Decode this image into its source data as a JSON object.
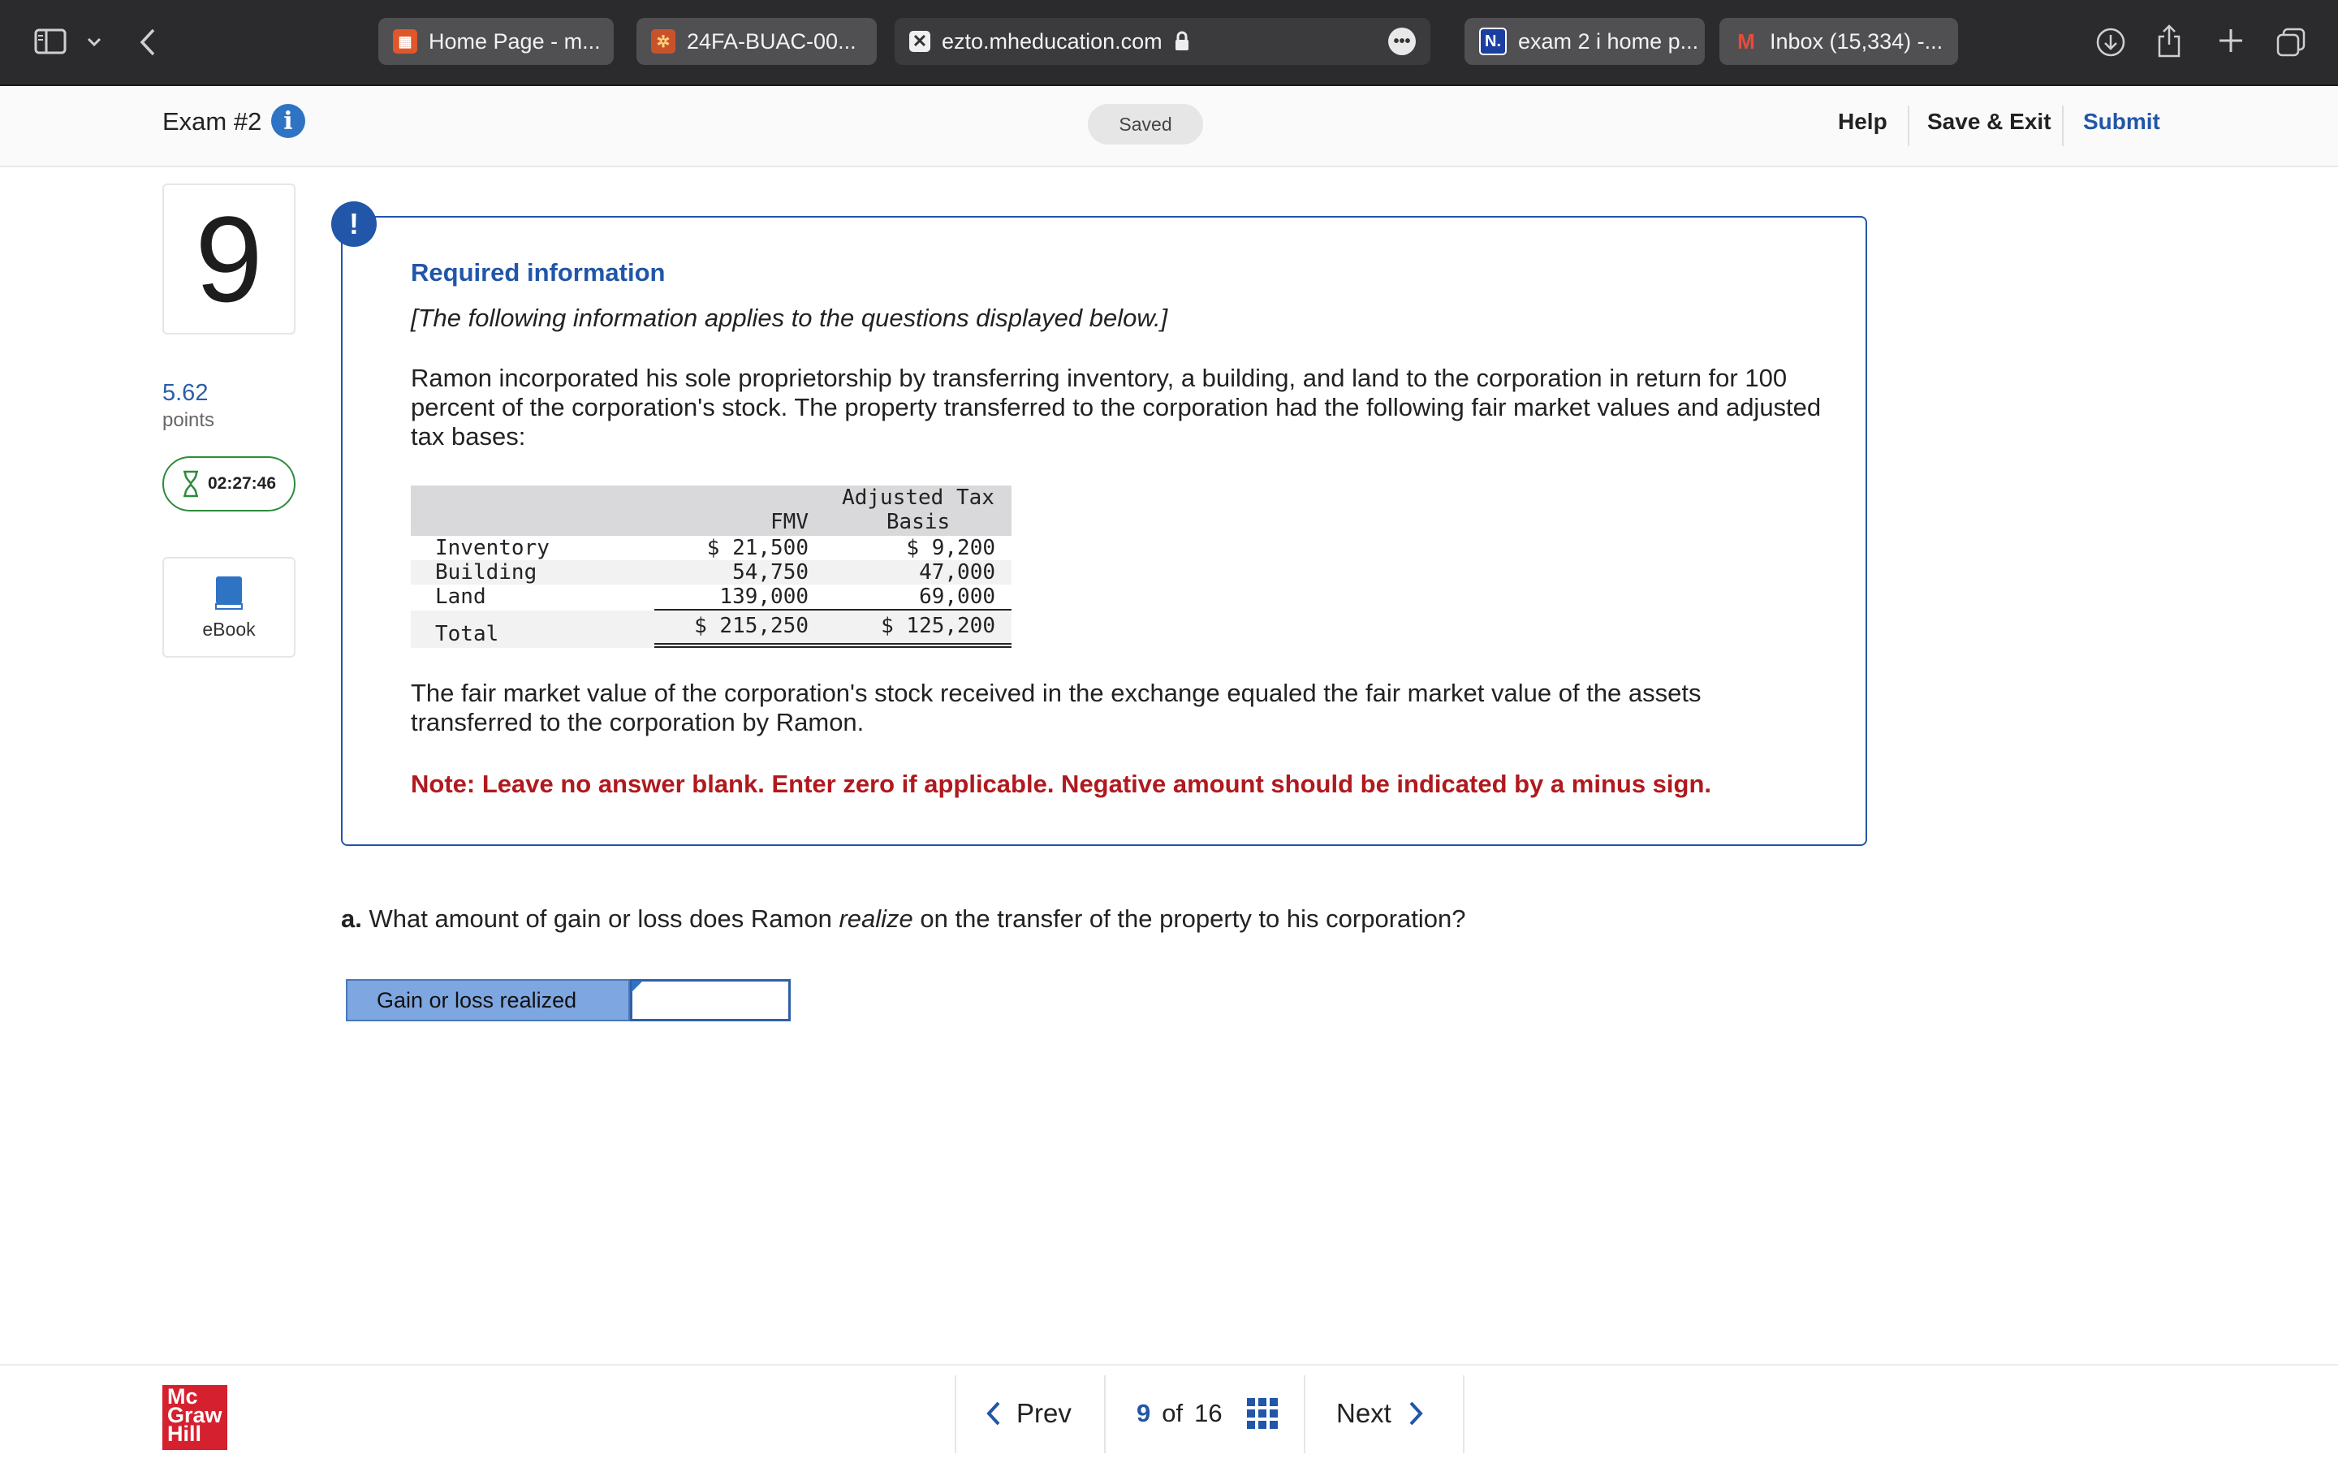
{
  "browser": {
    "tabs": [
      {
        "label": "Home Page - m...",
        "favicon": "canvas-icon"
      },
      {
        "label": "24FA-BUAC-00...",
        "favicon": "course-icon"
      },
      {
        "label": "ezto.mheducation.com",
        "favicon": "close-tab-icon",
        "active": true
      },
      {
        "label": "exam 2 i home p...",
        "favicon": "n-icon",
        "favicon_text": "N."
      },
      {
        "label": "Inbox (15,334) -...",
        "favicon": "gmail-icon"
      }
    ]
  },
  "header": {
    "exam_title": "Exam #2",
    "status": "Saved",
    "help": "Help",
    "save_exit": "Save & Exit",
    "submit": "Submit"
  },
  "sidebar": {
    "question_number": "9",
    "points_value": "5.62",
    "points_label": "points",
    "timer": "02:27:46",
    "ebook_label": "eBook"
  },
  "info": {
    "alert_symbol": "!",
    "title": "Required information",
    "subtitle": "[The following information applies to the questions displayed below.]",
    "paragraph1": "Ramon incorporated his sole proprietorship by transferring inventory, a building, and land to the corporation in return for 100 percent of the corporation's stock. The property transferred to the corporation had the following fair market values and adjusted tax bases:",
    "table": {
      "headers": {
        "fmv": "FMV",
        "atb_line1": "Adjusted Tax",
        "atb_line2": "Basis"
      },
      "rows": [
        {
          "label": "Inventory",
          "fmv": "$ 21,500",
          "atb": "$ 9,200"
        },
        {
          "label": "Building",
          "fmv": "54,750",
          "atb": "47,000"
        },
        {
          "label": "Land",
          "fmv": "139,000",
          "atb": "69,000"
        }
      ],
      "total": {
        "label": "Total",
        "fmv": "$ 215,250",
        "atb": "$ 125,200"
      }
    },
    "paragraph2": "The fair market value of the corporation's stock received in the exchange equaled the fair market value of the assets transferred to the corporation by Ramon.",
    "note": "Note: Leave no answer blank. Enter zero if applicable. Negative amount should be indicated by a minus sign."
  },
  "question": {
    "prefix": "a.",
    "text_before": "What amount of gain or loss does Ramon",
    "emphasis": "realize",
    "text_after": "on the transfer of the property to his corporation?",
    "answer_label": "Gain or loss realized",
    "answer_value": ""
  },
  "footer": {
    "logo": [
      "Mc",
      "Graw",
      "Hill"
    ],
    "prev": "Prev",
    "current": "9",
    "of": "of",
    "total": "16",
    "next": "Next"
  },
  "colors": {
    "accent": "#2156a8",
    "note_red": "#b0191e",
    "timer_green": "#2e8b3a",
    "brand_red": "#d5202f"
  }
}
